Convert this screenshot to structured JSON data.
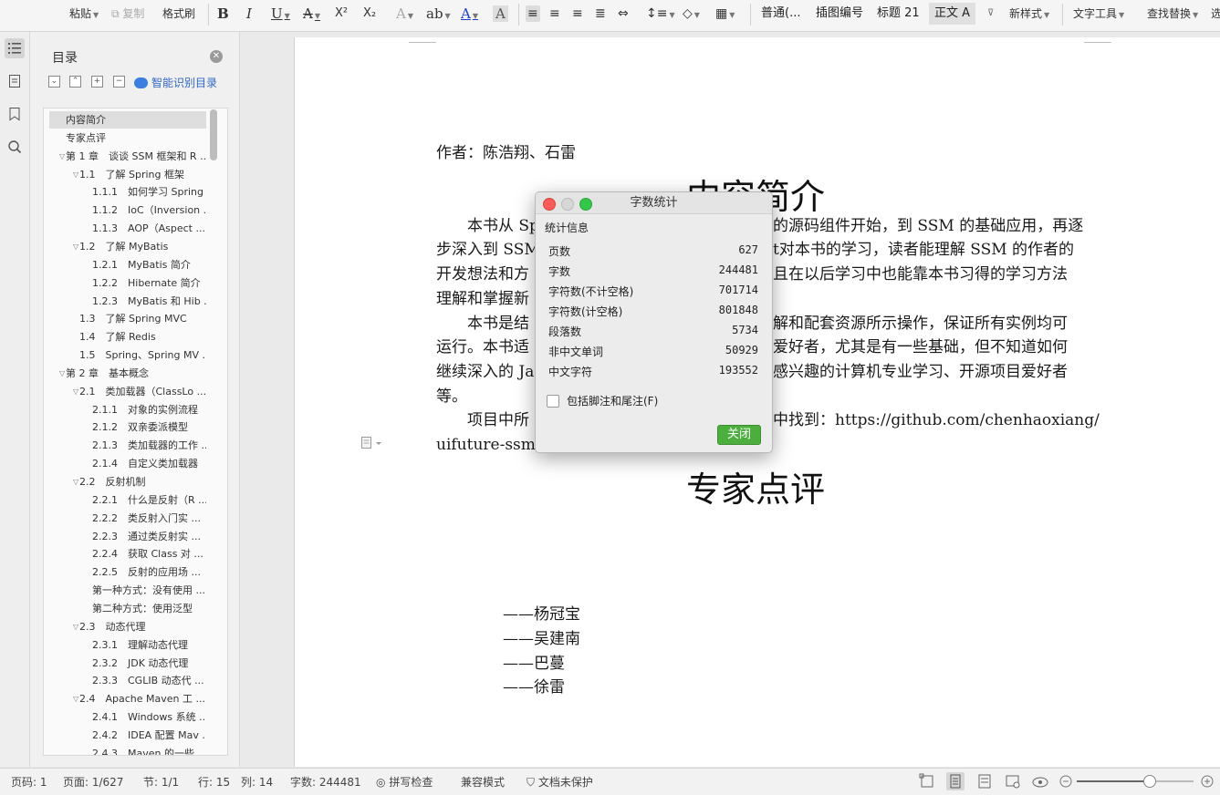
{
  "toolbar": {
    "paste": "粘贴",
    "copy": "复制",
    "format_painter": "格式刷",
    "bold": "B",
    "italic": "I",
    "underline": "U",
    "strike": "A",
    "sup": "X²",
    "sub": "X₂",
    "styles": [
      "普通(...",
      "插图编号",
      "标题 21",
      "正文 A"
    ],
    "new_style": "新样式",
    "text_tools": "文字工具",
    "find_replace": "查找替换",
    "select": "选"
  },
  "toc": {
    "title": "目录",
    "smart": "智能识别目录",
    "items": [
      {
        "label": "内容简介",
        "level": 0,
        "tri": false
      },
      {
        "label": "专家点评",
        "level": 0,
        "tri": false
      },
      {
        "label": "第 1 章　谈谈 SSM 框架和 R ...",
        "level": 0,
        "tri": true
      },
      {
        "label": "1.1　了解 Spring 框架",
        "level": 1,
        "tri": true
      },
      {
        "label": "1.1.1　如何学习 Spring",
        "level": 2,
        "tri": false
      },
      {
        "label": "1.1.2　IoC（Inversion ...",
        "level": 2,
        "tri": false
      },
      {
        "label": "1.1.3　AOP（Aspect ...",
        "level": 2,
        "tri": false
      },
      {
        "label": "1.2　了解 MyBatis",
        "level": 1,
        "tri": true
      },
      {
        "label": "1.2.1　MyBatis 简介",
        "level": 2,
        "tri": false
      },
      {
        "label": "1.2.2　Hibernate 简介",
        "level": 2,
        "tri": false
      },
      {
        "label": "1.2.3　MyBatis 和 Hib ...",
        "level": 2,
        "tri": false
      },
      {
        "label": "1.3　了解 Spring  MVC",
        "level": 1,
        "tri": false
      },
      {
        "label": "1.4　了解 Redis",
        "level": 1,
        "tri": false
      },
      {
        "label": "1.5　Spring、Spring  MV ...",
        "level": 1,
        "tri": false
      },
      {
        "label": "第 2 章　基本概念",
        "level": 0,
        "tri": true
      },
      {
        "label": "2.1　类加载器（ClassLo ...",
        "level": 1,
        "tri": true
      },
      {
        "label": "2.1.1　对象的实例流程",
        "level": 2,
        "tri": false
      },
      {
        "label": "2.1.2　双亲委派模型",
        "level": 2,
        "tri": false
      },
      {
        "label": "2.1.3　类加载器的工作 ...",
        "level": 2,
        "tri": false
      },
      {
        "label": "2.1.4　自定义类加载器",
        "level": 2,
        "tri": false
      },
      {
        "label": "2.2　反射机制",
        "level": 1,
        "tri": true
      },
      {
        "label": "2.2.1　什么是反射（R ...",
        "level": 2,
        "tri": false
      },
      {
        "label": "2.2.2　类反射入门实 ...",
        "level": 2,
        "tri": false
      },
      {
        "label": "2.2.3　通过类反射实 ...",
        "level": 2,
        "tri": false
      },
      {
        "label": "2.2.4　获取 Class 对 ...",
        "level": 2,
        "tri": false
      },
      {
        "label": "2.2.5　反射的应用场 ...",
        "level": 2,
        "tri": false
      },
      {
        "label": "第一种方式：没有使用 ...",
        "level": 2,
        "tri": false
      },
      {
        "label": "第二种方式：使用泛型",
        "level": 2,
        "tri": false
      },
      {
        "label": "2.3　动态代理",
        "level": 1,
        "tri": true
      },
      {
        "label": "2.3.1　理解动态代理",
        "level": 2,
        "tri": false
      },
      {
        "label": "2.3.2　JDK 动态代理",
        "level": 2,
        "tri": false
      },
      {
        "label": "2.3.3　CGLIB 动态代 ...",
        "level": 2,
        "tri": false
      },
      {
        "label": "2.4　Apache  Maven 工 ...",
        "level": 1,
        "tri": true
      },
      {
        "label": "2.4.1　Windows 系统 ...",
        "level": 2,
        "tri": false
      },
      {
        "label": "2.4.2　IDEA 配置 Mav ...",
        "level": 2,
        "tri": false
      },
      {
        "label": "2.4.3　Maven 的一些 ...",
        "level": 2,
        "tri": false
      }
    ]
  },
  "doc": {
    "author": "作者：陈浩翔、石雷",
    "heading1": "内容简介",
    "lines": [
      "　　本书从 Sp",
      "的源码组件开始，到 SSM 的基础应用，再逐",
      "步深入到 SSM",
      "t对本书的学习，读者能理解 SSM 的作者的",
      "开发想法和方",
      "且在以后学习中也能靠本书习得的学习方法",
      "理解和掌握新",
      "　　本书是结",
      "解和配套资源所示操作，保证所有实例均可",
      "运行。本书适",
      "爱好者，尤其是有一些基础，但不知道如何",
      "继续深入的 Ja",
      "感兴趣的计算机专业学习、开源项目爱好者",
      "等。",
      "　　项目中所",
      "中找到：https://github.com/chenhaoxiang/",
      "uifuture-ssm。"
    ],
    "heading2": "专家点评",
    "reviewers": [
      "——杨冠宝",
      "——吴建南",
      "——巴蔓",
      "——徐雷"
    ]
  },
  "dialog": {
    "title": "字数统计",
    "section": "统计信息",
    "rows": [
      {
        "k": "页数",
        "v": "627"
      },
      {
        "k": "字数",
        "v": "244481"
      },
      {
        "k": "字符数(不计空格)",
        "v": "701714"
      },
      {
        "k": "字符数(计空格)",
        "v": "801848"
      },
      {
        "k": "段落数",
        "v": "5734"
      },
      {
        "k": "非中文单词",
        "v": "50929"
      },
      {
        "k": "中文字符",
        "v": "193552"
      }
    ],
    "checkbox_label": "包括脚注和尾注(F)",
    "close": "关闭"
  },
  "status": {
    "page_code": "页码: 1",
    "pages": "页面: 1/627",
    "section": "节: 1/1",
    "row": "行: 15",
    "col": "列: 14",
    "words": "字数: 244481",
    "spell": "拼写检查",
    "compat": "兼容模式",
    "protect": "文档未保护"
  },
  "zoom": {
    "level": 0.62
  }
}
